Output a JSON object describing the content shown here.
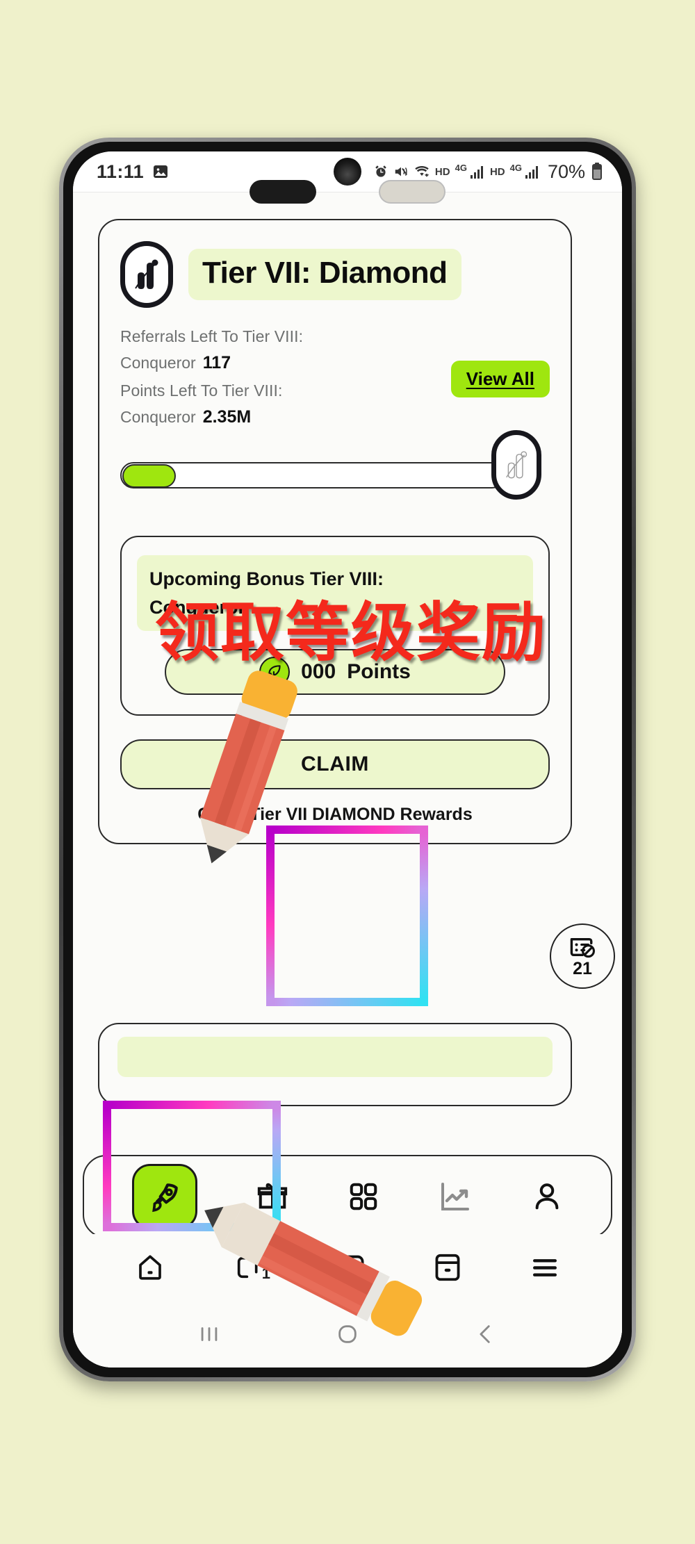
{
  "background_color": "#EFF1CB",
  "accent_green": "#9FE60F",
  "pale_green": "#EDF7CD",
  "annotation_red": "#F4291C",
  "status_bar": {
    "time": "11:11",
    "icons_left": [
      "image-icon"
    ],
    "icons_right": [
      "alarm-icon",
      "mute-icon",
      "wifi-icon",
      "hd-icon",
      "4g-signal-icon",
      "hd-icon",
      "4g-signal-icon"
    ],
    "hd_label_1": "HD",
    "net_label_1": "4G",
    "hd_label_2": "HD",
    "net_label_2": "4G",
    "battery_percent": "70%"
  },
  "tier_card": {
    "logo_icon": "brand-chart-logo-icon",
    "title": "Tier VII: Diamond",
    "referrals_label": "Referrals Left To Tier VIII:",
    "referrals_tier_name": "Conqueror",
    "referrals_value": "117",
    "points_label": "Points Left To Tier VIII:",
    "points_tier_name": "Conqueror",
    "points_value": "2.35M",
    "view_all_label": "View All",
    "progress_percent": 14,
    "progress_badge_icon": "brand-chart-logo-icon"
  },
  "bonus_card": {
    "banner_line1": "Upcoming Bonus Tier VIII:",
    "banner_line2": "Conqueror",
    "points_icon": "leaf-icon",
    "points_amount": "000",
    "points_unit": "Points"
  },
  "claim": {
    "button_label": "CLAIM",
    "subtitle": "Claim Tier VII DIAMOND Rewards"
  },
  "float_badge": {
    "icon": "blocked-list-icon",
    "count": "21"
  },
  "app_nav": {
    "items": [
      {
        "icon": "rocket-icon",
        "active": true
      },
      {
        "icon": "gift-icon",
        "active": false
      },
      {
        "icon": "grid-apps-icon",
        "active": false
      },
      {
        "icon": "chart-trend-icon",
        "active": false
      },
      {
        "icon": "person-icon",
        "active": false
      }
    ]
  },
  "browser_bar": {
    "items": [
      {
        "icon": "home-icon"
      },
      {
        "icon": "tabs-icon",
        "count": "1"
      },
      {
        "icon": "media-play-icon"
      },
      {
        "icon": "wallet-icon"
      },
      {
        "icon": "menu-icon"
      }
    ]
  },
  "android_nav": {
    "items": [
      "recents-icon",
      "home-circle-icon",
      "back-icon"
    ]
  },
  "annotations": {
    "chinese_caption": "领取等级奖励",
    "highlight_boxes": [
      "claim-button-highlight",
      "rocket-nav-highlight"
    ],
    "pencils": [
      "pencil-pointer-claim",
      "pencil-pointer-nav"
    ]
  }
}
